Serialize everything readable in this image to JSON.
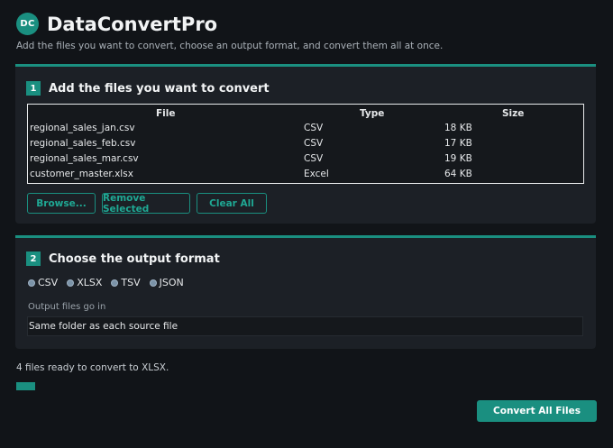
{
  "app": {
    "logo_text": "DC",
    "title": "DataConvertPro",
    "subtitle": "Add the files you want to convert, choose an output format, and convert them all at once."
  },
  "step1": {
    "number": "1",
    "title": "Add the files you want to convert",
    "columns": [
      "File",
      "Type",
      "Size"
    ],
    "files": [
      {
        "name": "regional_sales_jan.csv",
        "type": "CSV",
        "size": "18 KB"
      },
      {
        "name": "regional_sales_feb.csv",
        "type": "CSV",
        "size": "17 KB"
      },
      {
        "name": "regional_sales_mar.csv",
        "type": "CSV",
        "size": "19 KB"
      },
      {
        "name": "customer_master.xlsx",
        "type": "Excel",
        "size": "64 KB"
      }
    ],
    "buttons": {
      "browse": "Browse...",
      "remove": "Remove Selected",
      "clear": "Clear All"
    }
  },
  "step2": {
    "number": "2",
    "title": "Choose the output format",
    "formats": [
      "CSV",
      "XLSX",
      "TSV",
      "JSON"
    ],
    "output_label": "Output files go in",
    "output_value": "Same folder as each source file"
  },
  "status_text": "4 files ready to convert to XLSX.",
  "progress": 0,
  "convert_button": "Convert All Files",
  "colors": {
    "accent": "#1a8f80",
    "background": "#111418",
    "panel": "#1c2026"
  }
}
